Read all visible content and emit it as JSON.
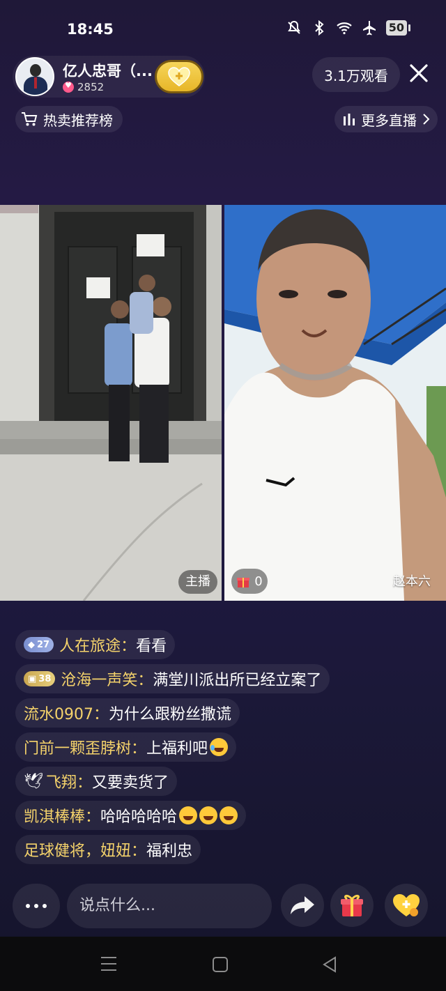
{
  "status": {
    "time": "18:45",
    "battery": "50"
  },
  "header": {
    "host_name": "亿人忠哥（...",
    "host_fans": "2852",
    "viewers": "3.1万观看",
    "hot_rank_label": "热卖推荐榜",
    "more_live_label": "更多直播"
  },
  "video": {
    "host_tag": "主播",
    "gift_count": "0",
    "guest_name": "赵本六"
  },
  "comments": [
    {
      "badge": "27",
      "user": "人在旅途",
      "sep": "：",
      "text": "看看"
    },
    {
      "badge": "38",
      "user": "沧海一声笑",
      "sep": "：",
      "text": "满堂川派出所已经立案了"
    },
    {
      "badge": "",
      "user": "流水0907",
      "sep": "：",
      "text": "为什么跟粉丝撒谎"
    },
    {
      "badge": "",
      "user": "门前一颗歪脖树",
      "sep": "：",
      "text": "上福利吧"
    },
    {
      "badge": "",
      "user": "飞翔",
      "sep": "：",
      "text": "又要卖货了"
    },
    {
      "badge": "",
      "user": "凯淇棒棒",
      "sep": "：",
      "text": "哈哈哈哈哈"
    },
    {
      "badge": "",
      "user": "足球健将，妞妞",
      "sep": "：",
      "text": "福利忠"
    }
  ],
  "bottom": {
    "input_placeholder": "说点什么..."
  },
  "colors": {
    "background": "#1e1940",
    "username": "#f5d36b",
    "follow": "#f2c94c"
  }
}
